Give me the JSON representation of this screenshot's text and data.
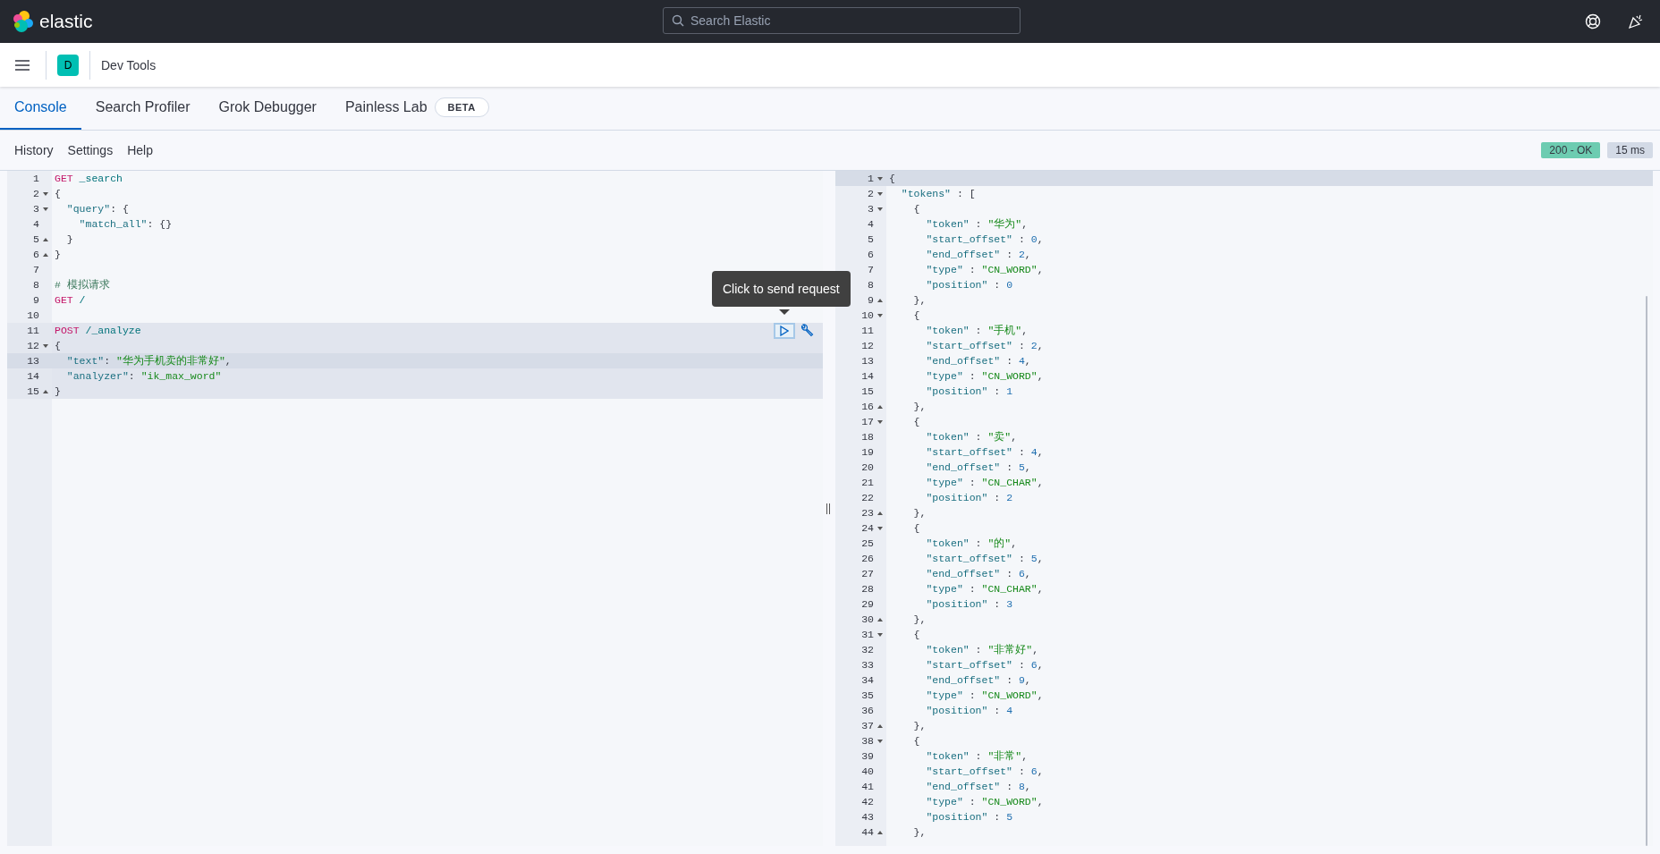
{
  "top_bar": {
    "brand": "elastic",
    "search": {
      "placeholder": "Search Elastic"
    }
  },
  "header": {
    "avatar": "D",
    "title": "Dev Tools"
  },
  "tabs": [
    {
      "label": "Console",
      "selected": true
    },
    {
      "label": "Search Profiler",
      "selected": false
    },
    {
      "label": "Grok Debugger",
      "selected": false
    },
    {
      "label": "Painless Lab",
      "selected": false,
      "badge": "BETA"
    }
  ],
  "toolbar": {
    "links": [
      "History",
      "Settings",
      "Help"
    ],
    "status": [
      {
        "kind": "status",
        "text": "200 - OK"
      },
      {
        "kind": "time",
        "text": "15 ms"
      }
    ]
  },
  "request_tooltip": "Click to send request",
  "request_editor": {
    "lines": [
      {
        "number": "1",
        "fold_start": false,
        "fold_end": false,
        "in_request": false,
        "active": false,
        "tokens": [
          {
            "kind": "method",
            "text": "GET"
          },
          {
            "kind": "path",
            "text": " _search"
          }
        ]
      },
      {
        "number": "2",
        "fold_start": true,
        "fold_end": false,
        "in_request": false,
        "active": false,
        "tokens": [
          {
            "kind": "punct",
            "text": "{"
          }
        ]
      },
      {
        "number": "3",
        "fold_start": true,
        "fold_end": false,
        "in_request": false,
        "active": false,
        "tokens": [
          {
            "kind": "key",
            "text": "  \"query\""
          },
          {
            "kind": "punct",
            "text": ": {"
          }
        ]
      },
      {
        "number": "4",
        "fold_start": false,
        "fold_end": false,
        "in_request": false,
        "active": false,
        "tokens": [
          {
            "kind": "key",
            "text": "    \"match_all\""
          },
          {
            "kind": "punct",
            "text": ": {}"
          }
        ]
      },
      {
        "number": "5",
        "fold_start": false,
        "fold_end": true,
        "in_request": false,
        "active": false,
        "tokens": [
          {
            "kind": "punct",
            "text": "  }"
          }
        ]
      },
      {
        "number": "6",
        "fold_start": false,
        "fold_end": true,
        "in_request": false,
        "active": false,
        "tokens": [
          {
            "kind": "punct",
            "text": "}"
          }
        ]
      },
      {
        "number": "7",
        "fold_start": false,
        "fold_end": false
      },
      {
        "number": "8",
        "fold_start": false,
        "fold_end": false,
        "in_request": false,
        "active": false,
        "tokens": [
          {
            "kind": "comment",
            "text": "# 模拟请求"
          }
        ]
      },
      {
        "number": "9",
        "fold_start": false,
        "fold_end": false,
        "in_request": false,
        "active": false,
        "tokens": [
          {
            "kind": "method",
            "text": "GET"
          },
          {
            "kind": "path",
            "text": " /"
          }
        ]
      },
      {
        "number": "10",
        "fold_start": false,
        "fold_end": false
      },
      {
        "number": "11",
        "fold_start": false,
        "fold_end": false,
        "in_request": true,
        "active": false,
        "tokens": [
          {
            "kind": "method",
            "text": "POST"
          },
          {
            "kind": "path",
            "text": " /_analyze"
          }
        ]
      },
      {
        "number": "12",
        "fold_start": true,
        "fold_end": false,
        "in_request": true,
        "active": false,
        "tokens": [
          {
            "kind": "punct",
            "text": "{"
          }
        ]
      },
      {
        "number": "13",
        "fold_start": false,
        "fold_end": false,
        "in_request": true,
        "active": true,
        "tokens": [
          {
            "kind": "key",
            "text": "  \"text\""
          },
          {
            "kind": "punct",
            "text": ": "
          },
          {
            "kind": "string",
            "text": "\"华为手机卖的非常好\""
          },
          {
            "kind": "punct",
            "text": ","
          }
        ]
      },
      {
        "number": "14",
        "fold_start": false,
        "fold_end": false,
        "in_request": true,
        "active": false,
        "tokens": [
          {
            "kind": "key",
            "text": "  \"analyzer\""
          },
          {
            "kind": "punct",
            "text": ": "
          },
          {
            "kind": "string",
            "text": "\"ik_max_word\""
          }
        ]
      },
      {
        "number": "15",
        "fold_start": false,
        "fold_end": true,
        "in_request": true,
        "active": false,
        "tokens": [
          {
            "kind": "punct",
            "text": "}"
          }
        ]
      }
    ]
  },
  "response_editor": {
    "lines": [
      {
        "number": "1",
        "fold_start": true,
        "fold_end": false,
        "active": true,
        "tokens": [
          {
            "kind": "punct",
            "text": "{"
          }
        ]
      },
      {
        "number": "2",
        "fold_start": true,
        "fold_end": false,
        "active": false,
        "tokens": [
          {
            "kind": "key",
            "text": "  \"tokens\""
          },
          {
            "kind": "punct",
            "text": " : ["
          }
        ]
      },
      {
        "number": "3",
        "fold_start": true,
        "fold_end": false,
        "active": false,
        "tokens": [
          {
            "kind": "punct",
            "text": "    {"
          }
        ]
      },
      {
        "number": "4",
        "fold_start": false,
        "fold_end": false,
        "active": false,
        "tokens": [
          {
            "kind": "key",
            "text": "      \"token\""
          },
          {
            "kind": "punct",
            "text": " : "
          },
          {
            "kind": "string",
            "text": "\"华为\""
          },
          {
            "kind": "punct",
            "text": ","
          }
        ]
      },
      {
        "number": "5",
        "fold_start": false,
        "fold_end": false,
        "active": false,
        "tokens": [
          {
            "kind": "key",
            "text": "      \"start_offset\""
          },
          {
            "kind": "punct",
            "text": " : "
          },
          {
            "kind": "number",
            "text": "0"
          },
          {
            "kind": "punct",
            "text": ","
          }
        ]
      },
      {
        "number": "6",
        "fold_start": false,
        "fold_end": false,
        "active": false,
        "tokens": [
          {
            "kind": "key",
            "text": "      \"end_offset\""
          },
          {
            "kind": "punct",
            "text": " : "
          },
          {
            "kind": "number",
            "text": "2"
          },
          {
            "kind": "punct",
            "text": ","
          }
        ]
      },
      {
        "number": "7",
        "fold_start": false,
        "fold_end": false,
        "active": false,
        "tokens": [
          {
            "kind": "key",
            "text": "      \"type\""
          },
          {
            "kind": "punct",
            "text": " : "
          },
          {
            "kind": "string",
            "text": "\"CN_WORD\""
          },
          {
            "kind": "punct",
            "text": ","
          }
        ]
      },
      {
        "number": "8",
        "fold_start": false,
        "fold_end": false,
        "active": false,
        "tokens": [
          {
            "kind": "key",
            "text": "      \"position\""
          },
          {
            "kind": "punct",
            "text": " : "
          },
          {
            "kind": "number",
            "text": "0"
          }
        ]
      },
      {
        "number": "9",
        "fold_start": false,
        "fold_end": true,
        "active": false,
        "tokens": [
          {
            "kind": "punct",
            "text": "    },"
          }
        ]
      },
      {
        "number": "10",
        "fold_start": true,
        "fold_end": false,
        "active": false,
        "tokens": [
          {
            "kind": "punct",
            "text": "    {"
          }
        ]
      },
      {
        "number": "11",
        "fold_start": false,
        "fold_end": false,
        "active": false,
        "tokens": [
          {
            "kind": "key",
            "text": "      \"token\""
          },
          {
            "kind": "punct",
            "text": " : "
          },
          {
            "kind": "string",
            "text": "\"手机\""
          },
          {
            "kind": "punct",
            "text": ","
          }
        ]
      },
      {
        "number": "12",
        "fold_start": false,
        "fold_end": false,
        "active": false,
        "tokens": [
          {
            "kind": "key",
            "text": "      \"start_offset\""
          },
          {
            "kind": "punct",
            "text": " : "
          },
          {
            "kind": "number",
            "text": "2"
          },
          {
            "kind": "punct",
            "text": ","
          }
        ]
      },
      {
        "number": "13",
        "fold_start": false,
        "fold_end": false,
        "active": false,
        "tokens": [
          {
            "kind": "key",
            "text": "      \"end_offset\""
          },
          {
            "kind": "punct",
            "text": " : "
          },
          {
            "kind": "number",
            "text": "4"
          },
          {
            "kind": "punct",
            "text": ","
          }
        ]
      },
      {
        "number": "14",
        "fold_start": false,
        "fold_end": false,
        "active": false,
        "tokens": [
          {
            "kind": "key",
            "text": "      \"type\""
          },
          {
            "kind": "punct",
            "text": " : "
          },
          {
            "kind": "string",
            "text": "\"CN_WORD\""
          },
          {
            "kind": "punct",
            "text": ","
          }
        ]
      },
      {
        "number": "15",
        "fold_start": false,
        "fold_end": false,
        "active": false,
        "tokens": [
          {
            "kind": "key",
            "text": "      \"position\""
          },
          {
            "kind": "punct",
            "text": " : "
          },
          {
            "kind": "number",
            "text": "1"
          }
        ]
      },
      {
        "number": "16",
        "fold_start": false,
        "fold_end": true,
        "active": false,
        "tokens": [
          {
            "kind": "punct",
            "text": "    },"
          }
        ]
      },
      {
        "number": "17",
        "fold_start": true,
        "fold_end": false,
        "active": false,
        "tokens": [
          {
            "kind": "punct",
            "text": "    {"
          }
        ]
      },
      {
        "number": "18",
        "fold_start": false,
        "fold_end": false,
        "active": false,
        "tokens": [
          {
            "kind": "key",
            "text": "      \"token\""
          },
          {
            "kind": "punct",
            "text": " : "
          },
          {
            "kind": "string",
            "text": "\"卖\""
          },
          {
            "kind": "punct",
            "text": ","
          }
        ]
      },
      {
        "number": "19",
        "fold_start": false,
        "fold_end": false,
        "active": false,
        "tokens": [
          {
            "kind": "key",
            "text": "      \"start_offset\""
          },
          {
            "kind": "punct",
            "text": " : "
          },
          {
            "kind": "number",
            "text": "4"
          },
          {
            "kind": "punct",
            "text": ","
          }
        ]
      },
      {
        "number": "20",
        "fold_start": false,
        "fold_end": false,
        "active": false,
        "tokens": [
          {
            "kind": "key",
            "text": "      \"end_offset\""
          },
          {
            "kind": "punct",
            "text": " : "
          },
          {
            "kind": "number",
            "text": "5"
          },
          {
            "kind": "punct",
            "text": ","
          }
        ]
      },
      {
        "number": "21",
        "fold_start": false,
        "fold_end": false,
        "active": false,
        "tokens": [
          {
            "kind": "key",
            "text": "      \"type\""
          },
          {
            "kind": "punct",
            "text": " : "
          },
          {
            "kind": "string",
            "text": "\"CN_CHAR\""
          },
          {
            "kind": "punct",
            "text": ","
          }
        ]
      },
      {
        "number": "22",
        "fold_start": false,
        "fold_end": false,
        "active": false,
        "tokens": [
          {
            "kind": "key",
            "text": "      \"position\""
          },
          {
            "kind": "punct",
            "text": " : "
          },
          {
            "kind": "number",
            "text": "2"
          }
        ]
      },
      {
        "number": "23",
        "fold_start": false,
        "fold_end": true,
        "active": false,
        "tokens": [
          {
            "kind": "punct",
            "text": "    },"
          }
        ]
      },
      {
        "number": "24",
        "fold_start": true,
        "fold_end": false,
        "active": false,
        "tokens": [
          {
            "kind": "punct",
            "text": "    {"
          }
        ]
      },
      {
        "number": "25",
        "fold_start": false,
        "fold_end": false,
        "active": false,
        "tokens": [
          {
            "kind": "key",
            "text": "      \"token\""
          },
          {
            "kind": "punct",
            "text": " : "
          },
          {
            "kind": "string",
            "text": "\"的\""
          },
          {
            "kind": "punct",
            "text": ","
          }
        ]
      },
      {
        "number": "26",
        "fold_start": false,
        "fold_end": false,
        "active": false,
        "tokens": [
          {
            "kind": "key",
            "text": "      \"start_offset\""
          },
          {
            "kind": "punct",
            "text": " : "
          },
          {
            "kind": "number",
            "text": "5"
          },
          {
            "kind": "punct",
            "text": ","
          }
        ]
      },
      {
        "number": "27",
        "fold_start": false,
        "fold_end": false,
        "active": false,
        "tokens": [
          {
            "kind": "key",
            "text": "      \"end_offset\""
          },
          {
            "kind": "punct",
            "text": " : "
          },
          {
            "kind": "number",
            "text": "6"
          },
          {
            "kind": "punct",
            "text": ","
          }
        ]
      },
      {
        "number": "28",
        "fold_start": false,
        "fold_end": false,
        "active": false,
        "tokens": [
          {
            "kind": "key",
            "text": "      \"type\""
          },
          {
            "kind": "punct",
            "text": " : "
          },
          {
            "kind": "string",
            "text": "\"CN_CHAR\""
          },
          {
            "kind": "punct",
            "text": ","
          }
        ]
      },
      {
        "number": "29",
        "fold_start": false,
        "fold_end": false,
        "active": false,
        "tokens": [
          {
            "kind": "key",
            "text": "      \"position\""
          },
          {
            "kind": "punct",
            "text": " : "
          },
          {
            "kind": "number",
            "text": "3"
          }
        ]
      },
      {
        "number": "30",
        "fold_start": false,
        "fold_end": true,
        "active": false,
        "tokens": [
          {
            "kind": "punct",
            "text": "    },"
          }
        ]
      },
      {
        "number": "31",
        "fold_start": true,
        "fold_end": false,
        "active": false,
        "tokens": [
          {
            "kind": "punct",
            "text": "    {"
          }
        ]
      },
      {
        "number": "32",
        "fold_start": false,
        "fold_end": false,
        "active": false,
        "tokens": [
          {
            "kind": "key",
            "text": "      \"token\""
          },
          {
            "kind": "punct",
            "text": " : "
          },
          {
            "kind": "string",
            "text": "\"非常好\""
          },
          {
            "kind": "punct",
            "text": ","
          }
        ]
      },
      {
        "number": "33",
        "fold_start": false,
        "fold_end": false,
        "active": false,
        "tokens": [
          {
            "kind": "key",
            "text": "      \"start_offset\""
          },
          {
            "kind": "punct",
            "text": " : "
          },
          {
            "kind": "number",
            "text": "6"
          },
          {
            "kind": "punct",
            "text": ","
          }
        ]
      },
      {
        "number": "34",
        "fold_start": false,
        "fold_end": false,
        "active": false,
        "tokens": [
          {
            "kind": "key",
            "text": "      \"end_offset\""
          },
          {
            "kind": "punct",
            "text": " : "
          },
          {
            "kind": "number",
            "text": "9"
          },
          {
            "kind": "punct",
            "text": ","
          }
        ]
      },
      {
        "number": "35",
        "fold_start": false,
        "fold_end": false,
        "active": false,
        "tokens": [
          {
            "kind": "key",
            "text": "      \"type\""
          },
          {
            "kind": "punct",
            "text": " : "
          },
          {
            "kind": "string",
            "text": "\"CN_WORD\""
          },
          {
            "kind": "punct",
            "text": ","
          }
        ]
      },
      {
        "number": "36",
        "fold_start": false,
        "fold_end": false,
        "active": false,
        "tokens": [
          {
            "kind": "key",
            "text": "      \"position\""
          },
          {
            "kind": "punct",
            "text": " : "
          },
          {
            "kind": "number",
            "text": "4"
          }
        ]
      },
      {
        "number": "37",
        "fold_start": false,
        "fold_end": true,
        "active": false,
        "tokens": [
          {
            "kind": "punct",
            "text": "    },"
          }
        ]
      },
      {
        "number": "38",
        "fold_start": true,
        "fold_end": false,
        "active": false,
        "tokens": [
          {
            "kind": "punct",
            "text": "    {"
          }
        ]
      },
      {
        "number": "39",
        "fold_start": false,
        "fold_end": false,
        "active": false,
        "tokens": [
          {
            "kind": "key",
            "text": "      \"token\""
          },
          {
            "kind": "punct",
            "text": " : "
          },
          {
            "kind": "string",
            "text": "\"非常\""
          },
          {
            "kind": "punct",
            "text": ","
          }
        ]
      },
      {
        "number": "40",
        "fold_start": false,
        "fold_end": false,
        "active": false,
        "tokens": [
          {
            "kind": "key",
            "text": "      \"start_offset\""
          },
          {
            "kind": "punct",
            "text": " : "
          },
          {
            "kind": "number",
            "text": "6"
          },
          {
            "kind": "punct",
            "text": ","
          }
        ]
      },
      {
        "number": "41",
        "fold_start": false,
        "fold_end": false,
        "active": false,
        "tokens": [
          {
            "kind": "key",
            "text": "      \"end_offset\""
          },
          {
            "kind": "punct",
            "text": " : "
          },
          {
            "kind": "number",
            "text": "8"
          },
          {
            "kind": "punct",
            "text": ","
          }
        ]
      },
      {
        "number": "42",
        "fold_start": false,
        "fold_end": false,
        "active": false,
        "tokens": [
          {
            "kind": "key",
            "text": "      \"type\""
          },
          {
            "kind": "punct",
            "text": " : "
          },
          {
            "kind": "string",
            "text": "\"CN_WORD\""
          },
          {
            "kind": "punct",
            "text": ","
          }
        ]
      },
      {
        "number": "43",
        "fold_start": false,
        "fold_end": false,
        "active": false,
        "tokens": [
          {
            "kind": "key",
            "text": "      \"position\""
          },
          {
            "kind": "punct",
            "text": " : "
          },
          {
            "kind": "number",
            "text": "5"
          }
        ]
      },
      {
        "number": "44",
        "fold_start": false,
        "fold_end": true,
        "active": false,
        "tokens": [
          {
            "kind": "punct",
            "text": "    },"
          }
        ]
      }
    ]
  }
}
